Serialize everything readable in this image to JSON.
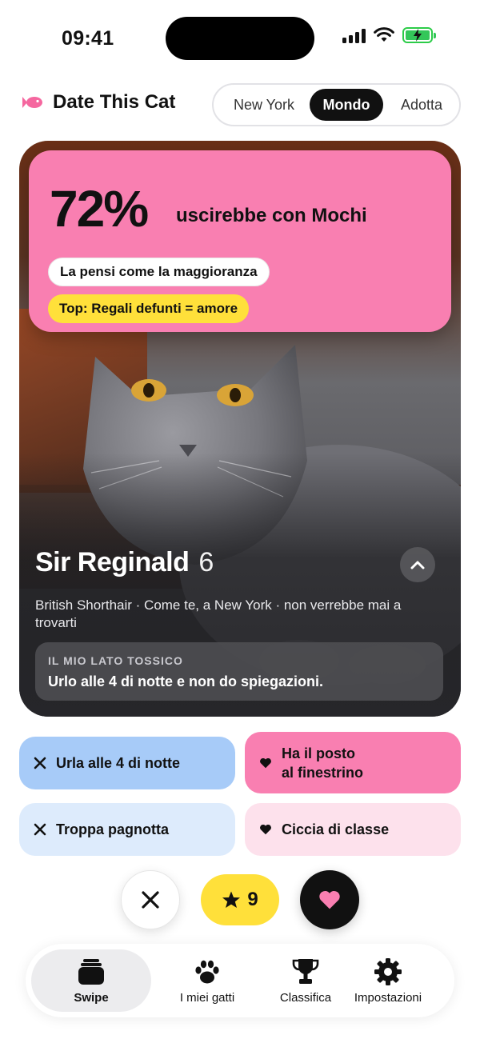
{
  "status_bar": {
    "time": "09:41"
  },
  "header": {
    "title": "Date This Cat",
    "segments": [
      "New York",
      "Mondo",
      "Adotta"
    ],
    "active_segment": "Mondo"
  },
  "card": {
    "match_percent": "72%",
    "match_text": "uscirebbe con Mochi",
    "chip_majority": "La pensi come la maggioranza",
    "chip_top": "Top: Regali defunti = amore",
    "name": "Sir Reginald",
    "age": "6",
    "description": "British Shorthair · Come te, a New York · non verrebbe mai a trovarti",
    "toxic_label": "IL MIO LATO TOSSICO",
    "toxic_text": "Urlo alle 4 di notte e non do spiegazioni."
  },
  "traits": [
    {
      "label": "Urla alle 4 di notte",
      "icon": "x-icon"
    },
    {
      "label": "Ha il posto al finestrino",
      "line1": "Ha il posto",
      "line2": "al finestrino",
      "icon": "heart-icon"
    },
    {
      "label": "Troppa pagnotta",
      "icon": "x-icon"
    },
    {
      "label": "Ciccia di classe",
      "icon": "heart-icon"
    }
  ],
  "actions": {
    "superlike_count": "9"
  },
  "tabs": [
    {
      "label": "Swipe",
      "icon": "cards-icon",
      "active": true
    },
    {
      "label": "I miei gatti",
      "icon": "paw-icon"
    },
    {
      "label": "Classifica",
      "icon": "trophy-icon"
    },
    {
      "label": "Impostazioni",
      "icon": "gear-icon"
    }
  ],
  "colors": {
    "pink": "#f97fb1",
    "yellow": "#ffe03a",
    "blue": "#a7cbf8",
    "light_blue": "#ddebfc",
    "light_pink": "#fde1ec",
    "dark": "#111111"
  }
}
